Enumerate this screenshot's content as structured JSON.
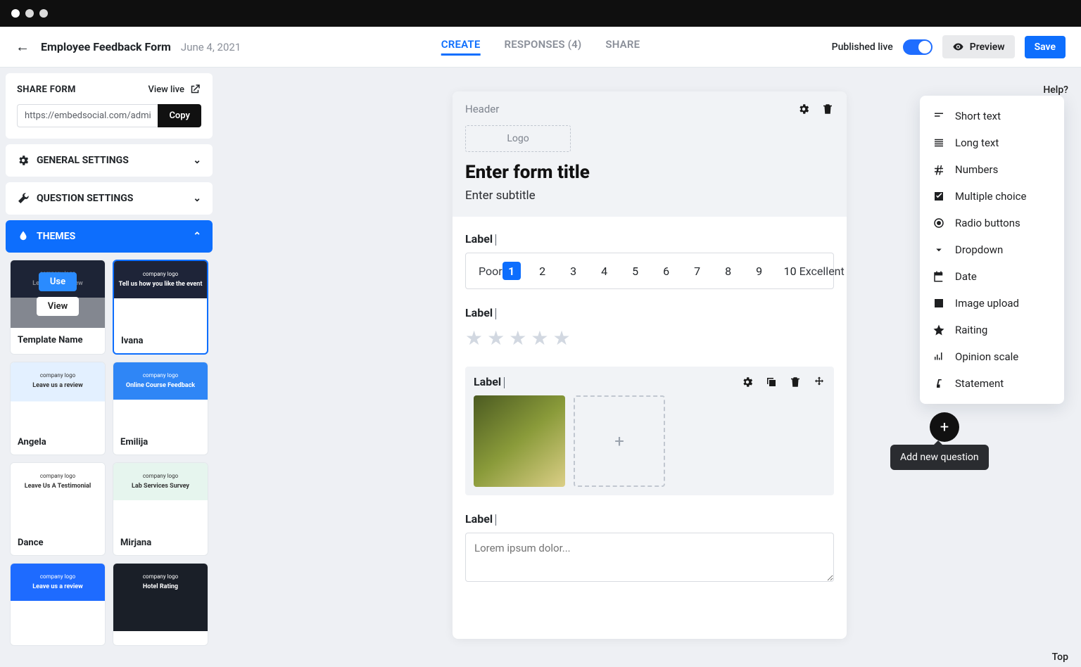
{
  "header": {
    "form_title": "Employee Feedback Form",
    "date": "June 4, 2021",
    "tabs": {
      "create": "CREATE",
      "responses": "RESPONSES (4)",
      "share": "SHARE"
    },
    "published_label": "Published live",
    "preview": "Preview",
    "save": "Save"
  },
  "sidebar": {
    "share": {
      "title": "SHARE FORM",
      "view_live": "View live",
      "url": "https://embedsocial.com/admin/edit_v",
      "copy": "Copy"
    },
    "general": "GENERAL SETTINGS",
    "question": "QUESTION SETTINGS",
    "themes": "THEMES",
    "templates": [
      {
        "name": "Template Name",
        "overlay": true,
        "thumb": "thumb-dark",
        "head": "Leave us a review"
      },
      {
        "name": "Ivana",
        "selected": true,
        "thumb": "thumb-dark",
        "head": "Tell us how you like the event"
      },
      {
        "name": "Angela",
        "thumb": "thumb-light1",
        "head": "Leave us a review"
      },
      {
        "name": "Emilija",
        "thumb": "thumb-blue",
        "head": "Online Course Feedback"
      },
      {
        "name": "Dance",
        "thumb": "thumb-white",
        "head": "Leave Us A Testimonial"
      },
      {
        "name": "Mirjana",
        "thumb": "thumb-green",
        "head": "Lab Services Survey"
      },
      {
        "name": "",
        "thumb": "thumb-brightblue",
        "head": "Leave us a review"
      },
      {
        "name": "",
        "thumb": "thumb-darkgray",
        "head": "Hotel Rating"
      }
    ],
    "overlay": {
      "use": "Use",
      "view": "View"
    }
  },
  "form": {
    "header_label": "Header",
    "logo_label": "Logo",
    "title": "Enter form title",
    "subtitle": "Enter subtitle",
    "label_text": "Label",
    "scale": {
      "low": "Poor",
      "high": "Excellent",
      "selected": 1,
      "nums": [
        1,
        2,
        3,
        4,
        5,
        6,
        7,
        8,
        9,
        10
      ]
    },
    "textarea_placeholder": "Lorem ipsum dolor..."
  },
  "qt_menu": {
    "items": [
      {
        "id": "short-text",
        "label": "Short text"
      },
      {
        "id": "long-text",
        "label": "Long text"
      },
      {
        "id": "numbers",
        "label": "Numbers"
      },
      {
        "id": "multiple-choice",
        "label": "Multiple choice"
      },
      {
        "id": "radio-buttons",
        "label": "Radio buttons"
      },
      {
        "id": "dropdown",
        "label": "Dropdown"
      },
      {
        "id": "date",
        "label": "Date"
      },
      {
        "id": "image-upload",
        "label": "Image upload"
      },
      {
        "id": "raiting",
        "label": "Raiting"
      },
      {
        "id": "opinion-scale",
        "label": "Opinion scale"
      },
      {
        "id": "statement",
        "label": "Statement"
      }
    ],
    "add_tooltip": "Add new question"
  },
  "floats": {
    "help": "Help?",
    "top": "Top"
  }
}
